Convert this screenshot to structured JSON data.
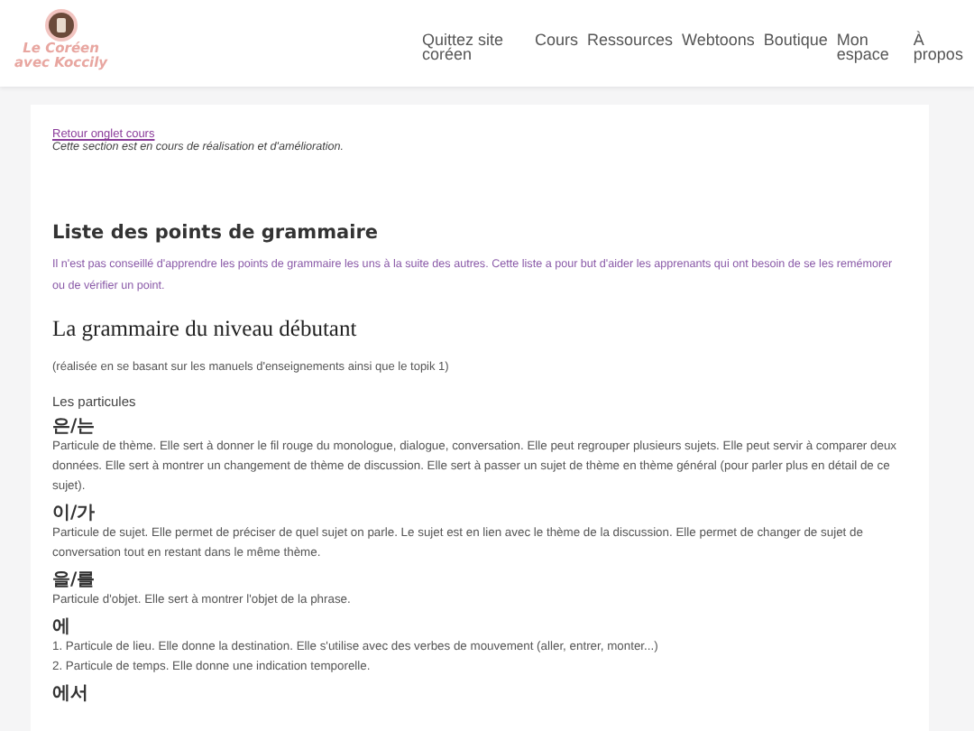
{
  "logo": {
    "line_1": "Le Coréen",
    "line_2": "avec Koccily"
  },
  "nav": [
    {
      "label": "Quittez site coréen"
    },
    {
      "label": "Cours"
    },
    {
      "label": "Ressources"
    },
    {
      "label": "Webtoons"
    },
    {
      "label": "Boutique"
    },
    {
      "label": "Mon espace"
    },
    {
      "label": "À propos"
    }
  ],
  "back_link": "Retour onglet cours",
  "notice": "Cette section est en cours de réalisation et d'amélioration.",
  "list_title": "Liste des points de grammaire",
  "intro": "Il n'est pas conseillé d'apprendre les points de grammaire les uns à la suite des autres. Cette liste a pour but d'aider les apprenants qui ont besoin de se les remémorer ou de vérifier un point.",
  "level_title": "La grammaire du niveau débutant",
  "level_note": "(réalisée en se basant sur les manuels d'enseignements ainsi que le topik 1)",
  "section_title": "Les particules",
  "particles": [
    {
      "term": "은/는",
      "lines": [
        "Particule de thème. Elle sert à donner le fil rouge du monologue, dialogue, conversation. Elle peut regrouper plusieurs sujets. Elle peut servir à comparer deux données. Elle sert à montrer un changement de thème de discussion. Elle sert à passer un sujet de thème en thème général (pour parler plus en détail de ce sujet)."
      ]
    },
    {
      "term": "이/가",
      "lines": [
        "Particule de sujet. Elle permet de préciser de quel sujet on parle. Le sujet est en lien avec le thème de la discussion. Elle permet de changer de sujet de conversation tout en restant dans le même thème."
      ]
    },
    {
      "term": "을/를",
      "lines": [
        "Particule d'objet. Elle sert à montrer l'objet de la phrase."
      ]
    },
    {
      "term": "에",
      "lines": [
        "1. Particule de lieu. Elle donne la destination. Elle s'utilise avec des verbes de mouvement (aller, entrer, monter...)",
        "2. Particule de temps. Elle donne une indication temporelle."
      ]
    },
    {
      "term": "에서"
    }
  ]
}
